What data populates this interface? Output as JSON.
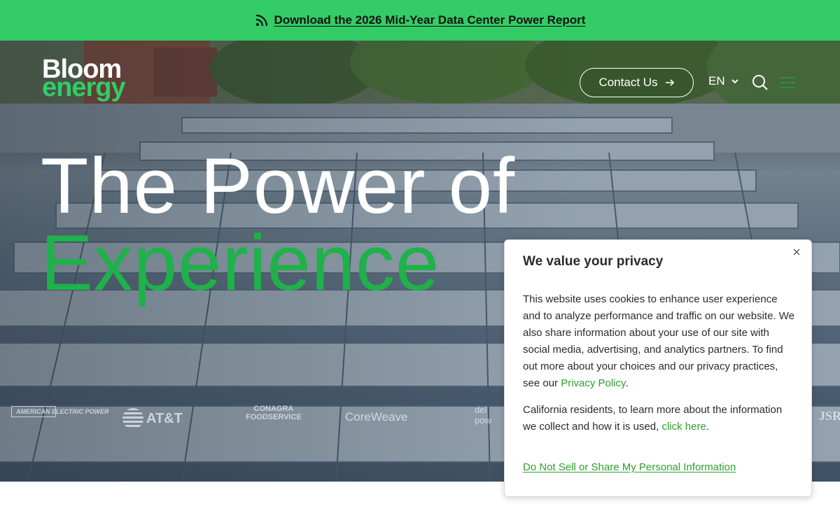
{
  "banner": {
    "icon": "rss-feed-icon",
    "link_text": "Download the 2026 Mid-Year Data Center Power Report",
    "background": "#33cc66"
  },
  "header": {
    "logo_line1": "Bloom",
    "logo_line2": "energy",
    "contact_label": "Contact Us",
    "language": "EN",
    "icons": [
      "arrow-right-icon",
      "chevron-down-icon",
      "search-icon",
      "menu-icon"
    ]
  },
  "hero": {
    "headline_line1": "The Power of",
    "headline_line2": "Experience",
    "accent_color": "#1fb14a"
  },
  "partners": {
    "p1": "AMERICAN ELECTRIC POWER",
    "p2": "AT&T",
    "p3_line1": "CONAGRA",
    "p3_line2": "FOODSERVICE",
    "p4": "CoreWeave",
    "p5_line1": "del",
    "p5_line2": "pow",
    "p6": "JSR"
  },
  "cookie": {
    "title": "We value your privacy",
    "body_text": "This website uses cookies to enhance user experience and to analyze performance and traffic on our website. We also share information about your use of our site with social media, advertising, and analytics partners.  To find out more about your choices and our privacy practices, see our ",
    "privacy_link": "Privacy Policy",
    "body_end": ".",
    "ca_text": "California residents, to learn more about the information we collect and how it is used, ",
    "ca_link": "click here",
    "ca_end": ".",
    "dns_link": "Do Not Sell or Share My Personal Information",
    "link_color": "#2f9e2f"
  }
}
